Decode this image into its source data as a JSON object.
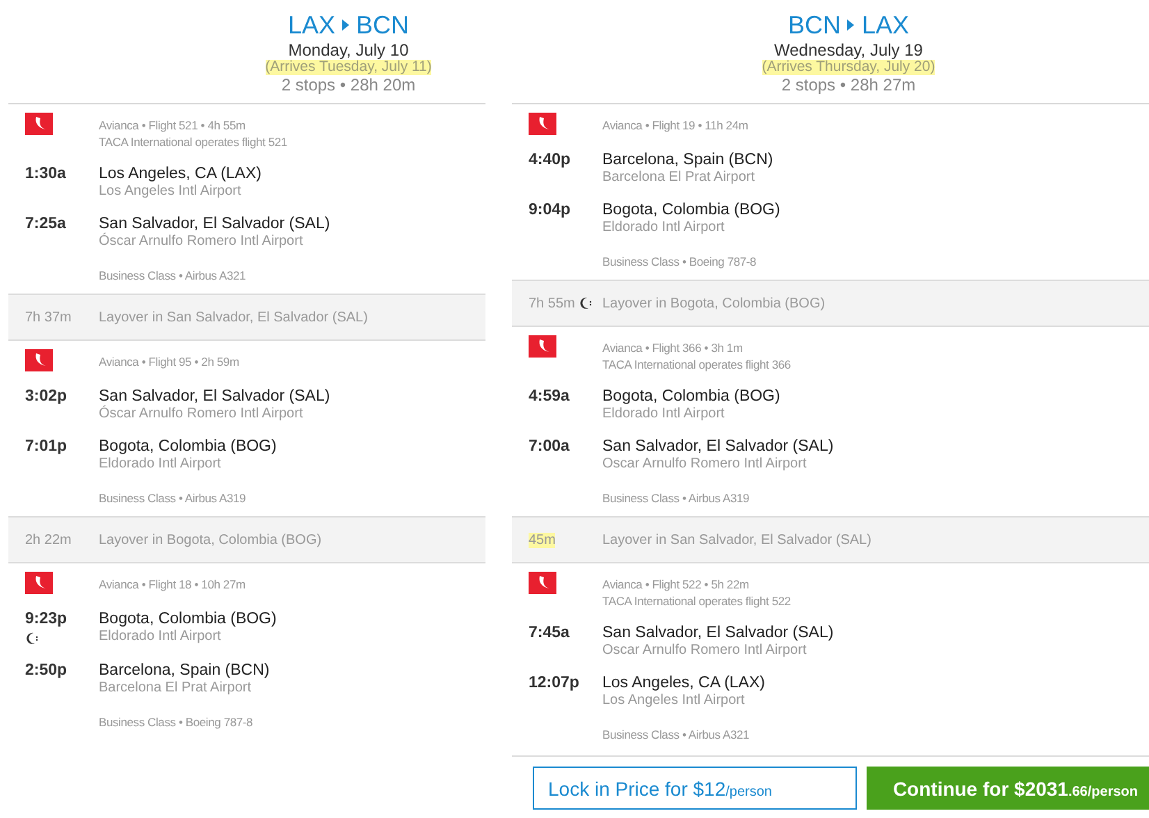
{
  "trips": [
    {
      "from": "LAX",
      "to": "BCN",
      "depart": "Monday, July 10",
      "arrives": "(Arrives Tuesday, July 11)",
      "summary": "2 stops • 28h 20m",
      "items": [
        {
          "kind": "flight",
          "info": "Avianca • Flight 521 • 4h 55m",
          "operated": "TACA International operates flight 521",
          "stops": [
            {
              "time": "1:30a",
              "city": "Los Angeles, CA (LAX)",
              "airport": "Los Angeles Intl Airport",
              "overnight": false
            },
            {
              "time": "7:25a",
              "city": "San Salvador, El Salvador (SAL)",
              "airport": "Óscar Arnulfo Romero Intl Airport",
              "overnight": false
            }
          ],
          "cabin": "Business Class • Airbus A321"
        },
        {
          "kind": "layover",
          "duration": "7h 37m",
          "text": "Layover in San Salvador, El Salvador (SAL)",
          "highlighted": false,
          "overnight": false
        },
        {
          "kind": "flight",
          "info": "Avianca • Flight 95 • 2h 59m",
          "stops": [
            {
              "time": "3:02p",
              "city": "San Salvador, El Salvador (SAL)",
              "airport": "Óscar Arnulfo Romero Intl Airport",
              "overnight": false
            },
            {
              "time": "7:01p",
              "city": "Bogota, Colombia (BOG)",
              "airport": "Eldorado Intl Airport",
              "overnight": false
            }
          ],
          "cabin": "Business Class • Airbus A319"
        },
        {
          "kind": "layover",
          "duration": "2h 22m",
          "text": "Layover in Bogota, Colombia (BOG)",
          "highlighted": false,
          "overnight": false
        },
        {
          "kind": "flight",
          "info": "Avianca • Flight 18 • 10h 27m",
          "stops": [
            {
              "time": "9:23p",
              "city": "Bogota, Colombia (BOG)",
              "airport": "Eldorado Intl Airport",
              "overnight": true
            },
            {
              "time": "2:50p",
              "city": "Barcelona, Spain (BCN)",
              "airport": "Barcelona El Prat Airport",
              "overnight": false
            }
          ],
          "cabin": "Business Class • Boeing 787-8"
        }
      ]
    },
    {
      "from": "BCN",
      "to": "LAX",
      "depart": "Wednesday, July 19",
      "arrives": "(Arrives Thursday, July 20)",
      "summary": "2 stops • 28h 27m",
      "items": [
        {
          "kind": "flight",
          "info": "Avianca • Flight 19 • 11h 24m",
          "stops": [
            {
              "time": "4:40p",
              "city": "Barcelona, Spain (BCN)",
              "airport": "Barcelona El Prat Airport",
              "overnight": false
            },
            {
              "time": "9:04p",
              "city": "Bogota, Colombia (BOG)",
              "airport": "Eldorado Intl Airport",
              "overnight": false
            }
          ],
          "cabin": "Business Class • Boeing 787-8"
        },
        {
          "kind": "layover",
          "duration": "7h 55m",
          "text": "Layover in Bogota, Colombia (BOG)",
          "highlighted": false,
          "overnight": true
        },
        {
          "kind": "flight",
          "info": "Avianca • Flight 366 • 3h 1m",
          "operated": "TACA International operates flight 366",
          "stops": [
            {
              "time": "4:59a",
              "city": "Bogota, Colombia (BOG)",
              "airport": "Eldorado Intl Airport",
              "overnight": false
            },
            {
              "time": "7:00a",
              "city": "San Salvador, El Salvador (SAL)",
              "airport": "Oscar Arnulfo Romero Intl Airport",
              "overnight": false
            }
          ],
          "cabin": "Business Class • Airbus A319"
        },
        {
          "kind": "layover",
          "duration": "45m",
          "text": "Layover in San Salvador, El Salvador (SAL)",
          "highlighted": true,
          "overnight": false
        },
        {
          "kind": "flight",
          "info": "Avianca • Flight 522 • 5h 22m",
          "operated": "TACA International operates flight 522",
          "stops": [
            {
              "time": "7:45a",
              "city": "San Salvador, El Salvador (SAL)",
              "airport": "Oscar Arnulfo Romero Intl Airport",
              "overnight": false
            },
            {
              "time": "12:07p",
              "city": "Los Angeles, CA (LAX)",
              "airport": "Los Angeles Intl Airport",
              "overnight": false
            }
          ],
          "cabin": "Business Class • Airbus A321"
        }
      ]
    }
  ],
  "lock_button": {
    "label": "Lock in Price for $12",
    "unit": "/person"
  },
  "continue_button": {
    "label": "Continue for $2031",
    "unit": ".66/person"
  }
}
